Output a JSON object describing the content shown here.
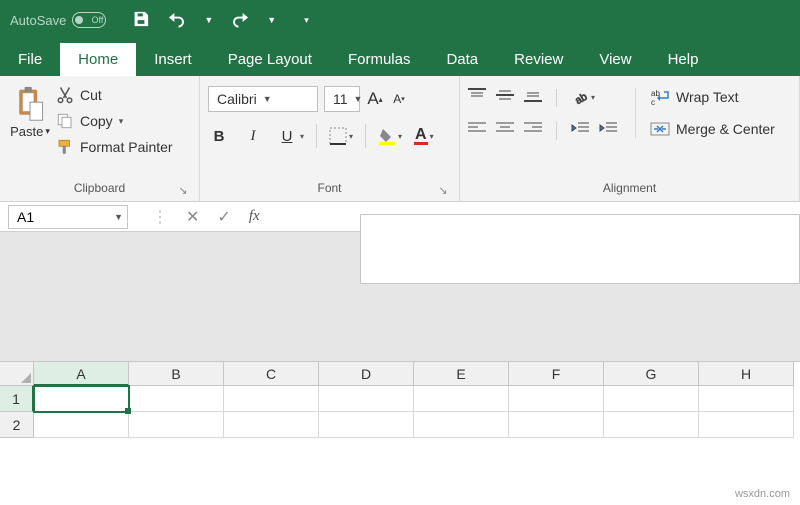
{
  "titlebar": {
    "autosave_label": "AutoSave",
    "autosave_state": "Off"
  },
  "tabs": {
    "file": "File",
    "home": "Home",
    "insert": "Insert",
    "page_layout": "Page Layout",
    "formulas": "Formulas",
    "data": "Data",
    "review": "Review",
    "view": "View",
    "help": "Help"
  },
  "ribbon": {
    "clipboard": {
      "label": "Clipboard",
      "paste": "Paste",
      "cut": "Cut",
      "copy": "Copy",
      "format_painter": "Format Painter"
    },
    "font": {
      "label": "Font",
      "name": "Calibri",
      "size": "11",
      "bold": "B",
      "italic": "I",
      "underline": "U",
      "font_color_glyph": "A",
      "grow": "A",
      "shrink": "A"
    },
    "alignment": {
      "label": "Alignment",
      "wrap": "Wrap Text",
      "merge": "Merge & Center"
    }
  },
  "formula_bar": {
    "name_box": "A1",
    "fx_label": "fx",
    "value": ""
  },
  "grid": {
    "columns": [
      "A",
      "B",
      "C",
      "D",
      "E",
      "F",
      "G",
      "H"
    ],
    "rows": [
      "1",
      "2"
    ],
    "active_cell": "A1"
  },
  "watermark": "wsxdn.com"
}
